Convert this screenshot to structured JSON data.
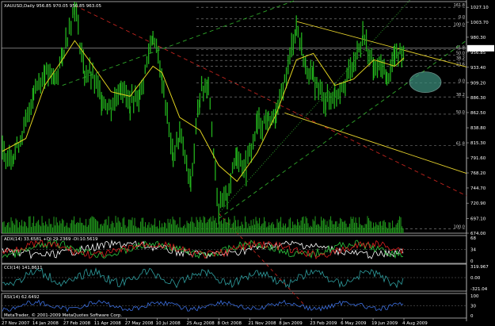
{
  "chart_data": {
    "type": "line",
    "colors": {
      "background": "#000000",
      "panel_border": "#bdbdbd",
      "candles": "#22b11c",
      "volume": "#1f8f1a",
      "moving_average": "#e0d21f",
      "channel_yellow": "#e3cf2b",
      "channel_green": "#2fa82a",
      "channel_red": "#c0241e",
      "fib_lines": "#8c8c8c",
      "price_label_bg": "#ffffff",
      "adx_main": "#ffffff",
      "adx_plus_di": "#2ecc40",
      "adx_minus_di": "#e02020",
      "cci_line": "#2f9fa0",
      "rsi_line": "#3c6fe0",
      "ellipse": "#3a8a78"
    },
    "main": {
      "title": "XAUUSD,Daily   956.85  970.05  950.85  963.05",
      "price_label": "963.05",
      "y_ticks": [
        "1027.10",
        "1003.70",
        "980.30",
        "956.85",
        "933.40",
        "909.20",
        "886.30",
        "862.50",
        "838.80",
        "815.30",
        "791.60",
        "768.20",
        "744.70",
        "720.90",
        "697.10",
        "674.00"
      ],
      "fib_levels": [
        {
          "label": "161.8",
          "y": 1027.1
        },
        {
          "label": "0.0",
          "y": 1009.0
        },
        {
          "label": "100.0",
          "y": 997.0
        },
        {
          "label": "61.8",
          "y": 961.0
        },
        {
          "label": "50.0",
          "y": 952.5
        },
        {
          "label": "38.2",
          "y": 944.0
        },
        {
          "label": "23.6",
          "y": 935.0
        },
        {
          "label": "0.0",
          "y": 909.2
        },
        {
          "label": "38.2",
          "y": 887.0
        },
        {
          "label": "50.0",
          "y": 860.0
        },
        {
          "label": "61.8",
          "y": 811.0
        },
        {
          "label": "100.0",
          "y": 681.0
        }
      ]
    },
    "price_series": [
      {
        "date": "2007-11-27",
        "close": 800
      },
      {
        "date": "2007-12-14",
        "close": 795
      },
      {
        "date": "2008-01-02",
        "close": 845
      },
      {
        "date": "2008-01-14",
        "close": 895
      },
      {
        "date": "2008-01-31",
        "close": 925
      },
      {
        "date": "2008-02-15",
        "close": 915
      },
      {
        "date": "2008-02-27",
        "close": 950
      },
      {
        "date": "2008-03-17",
        "close": 1030
      },
      {
        "date": "2008-04-01",
        "close": 925
      },
      {
        "date": "2008-04-11",
        "close": 920
      },
      {
        "date": "2008-04-28",
        "close": 885
      },
      {
        "date": "2008-05-12",
        "close": 870
      },
      {
        "date": "2008-05-27",
        "close": 905
      },
      {
        "date": "2008-06-10",
        "close": 875
      },
      {
        "date": "2008-06-25",
        "close": 890
      },
      {
        "date": "2008-07-15",
        "close": 985
      },
      {
        "date": "2008-07-29",
        "close": 915
      },
      {
        "date": "2008-08-15",
        "close": 790
      },
      {
        "date": "2008-08-25",
        "close": 830
      },
      {
        "date": "2008-09-11",
        "close": 750
      },
      {
        "date": "2008-09-25",
        "close": 890
      },
      {
        "date": "2008-10-08",
        "close": 910
      },
      {
        "date": "2008-10-24",
        "close": 705
      },
      {
        "date": "2008-11-06",
        "close": 735
      },
      {
        "date": "2008-11-21",
        "close": 800
      },
      {
        "date": "2008-12-05",
        "close": 775
      },
      {
        "date": "2008-12-22",
        "close": 845
      },
      {
        "date": "2009-01-08",
        "close": 850
      },
      {
        "date": "2009-01-20",
        "close": 855
      },
      {
        "date": "2009-02-02",
        "close": 910
      },
      {
        "date": "2009-02-20",
        "close": 1000
      },
      {
        "date": "2009-03-06",
        "close": 935
      },
      {
        "date": "2009-03-18",
        "close": 915
      },
      {
        "date": "2009-04-06",
        "close": 880
      },
      {
        "date": "2009-04-20",
        "close": 890
      },
      {
        "date": "2009-05-06",
        "close": 915
      },
      {
        "date": "2009-05-19",
        "close": 935
      },
      {
        "date": "2009-06-02",
        "close": 985
      },
      {
        "date": "2009-06-19",
        "close": 930
      },
      {
        "date": "2009-07-02",
        "close": 935
      },
      {
        "date": "2009-07-09",
        "close": 915
      },
      {
        "date": "2009-07-21",
        "close": 950
      },
      {
        "date": "2009-08-04",
        "close": 963
      }
    ],
    "moving_average": [
      {
        "date": "2007-11-27",
        "v": 802
      },
      {
        "date": "2008-01-02",
        "v": 822
      },
      {
        "date": "2008-01-31",
        "v": 905
      },
      {
        "date": "2008-02-27",
        "v": 945
      },
      {
        "date": "2008-03-17",
        "v": 975
      },
      {
        "date": "2008-04-11",
        "v": 940
      },
      {
        "date": "2008-05-12",
        "v": 895
      },
      {
        "date": "2008-06-10",
        "v": 888
      },
      {
        "date": "2008-07-15",
        "v": 935
      },
      {
        "date": "2008-07-29",
        "v": 925
      },
      {
        "date": "2008-08-25",
        "v": 855
      },
      {
        "date": "2008-09-25",
        "v": 835
      },
      {
        "date": "2008-10-24",
        "v": 780
      },
      {
        "date": "2008-11-21",
        "v": 755
      },
      {
        "date": "2008-12-22",
        "v": 800
      },
      {
        "date": "2009-01-20",
        "v": 860
      },
      {
        "date": "2009-02-20",
        "v": 945
      },
      {
        "date": "2009-03-18",
        "v": 955
      },
      {
        "date": "2009-04-20",
        "v": 905
      },
      {
        "date": "2009-05-19",
        "v": 915
      },
      {
        "date": "2009-06-19",
        "v": 945
      },
      {
        "date": "2009-07-21",
        "v": 935
      },
      {
        "date": "2009-08-04",
        "v": 948
      }
    ],
    "x_ticks": [
      "27 Nov 2007",
      "14 Jan 2008",
      "27 Feb 2008",
      "11 Apr 2008",
      "27 May 2008",
      "10 Jul 2008",
      "25 Aug 2008",
      "8 Oct 2008",
      "21 Nov 2008",
      "8 Jan 2009",
      "23 Feb 2009",
      "6 May 2009",
      "19 Jun 2009",
      "4 Aug 2009"
    ],
    "adx": {
      "title": "ADX(14) 33.6581 +DI:29.2369 -DI:10.5619",
      "y_ticks": [
        "68",
        "34",
        "0"
      ]
    },
    "cci": {
      "title": "CCI(14) 141.8611",
      "y_ticks": [
        "319.967",
        "0.00",
        "-321.04"
      ]
    },
    "rsi": {
      "title": "RSI(14) 62.6492",
      "y_ticks": [
        "100",
        "30",
        "0"
      ]
    },
    "footer": "MetaTrader, © 2001-2009 MetaQuotes Software Corp."
  }
}
